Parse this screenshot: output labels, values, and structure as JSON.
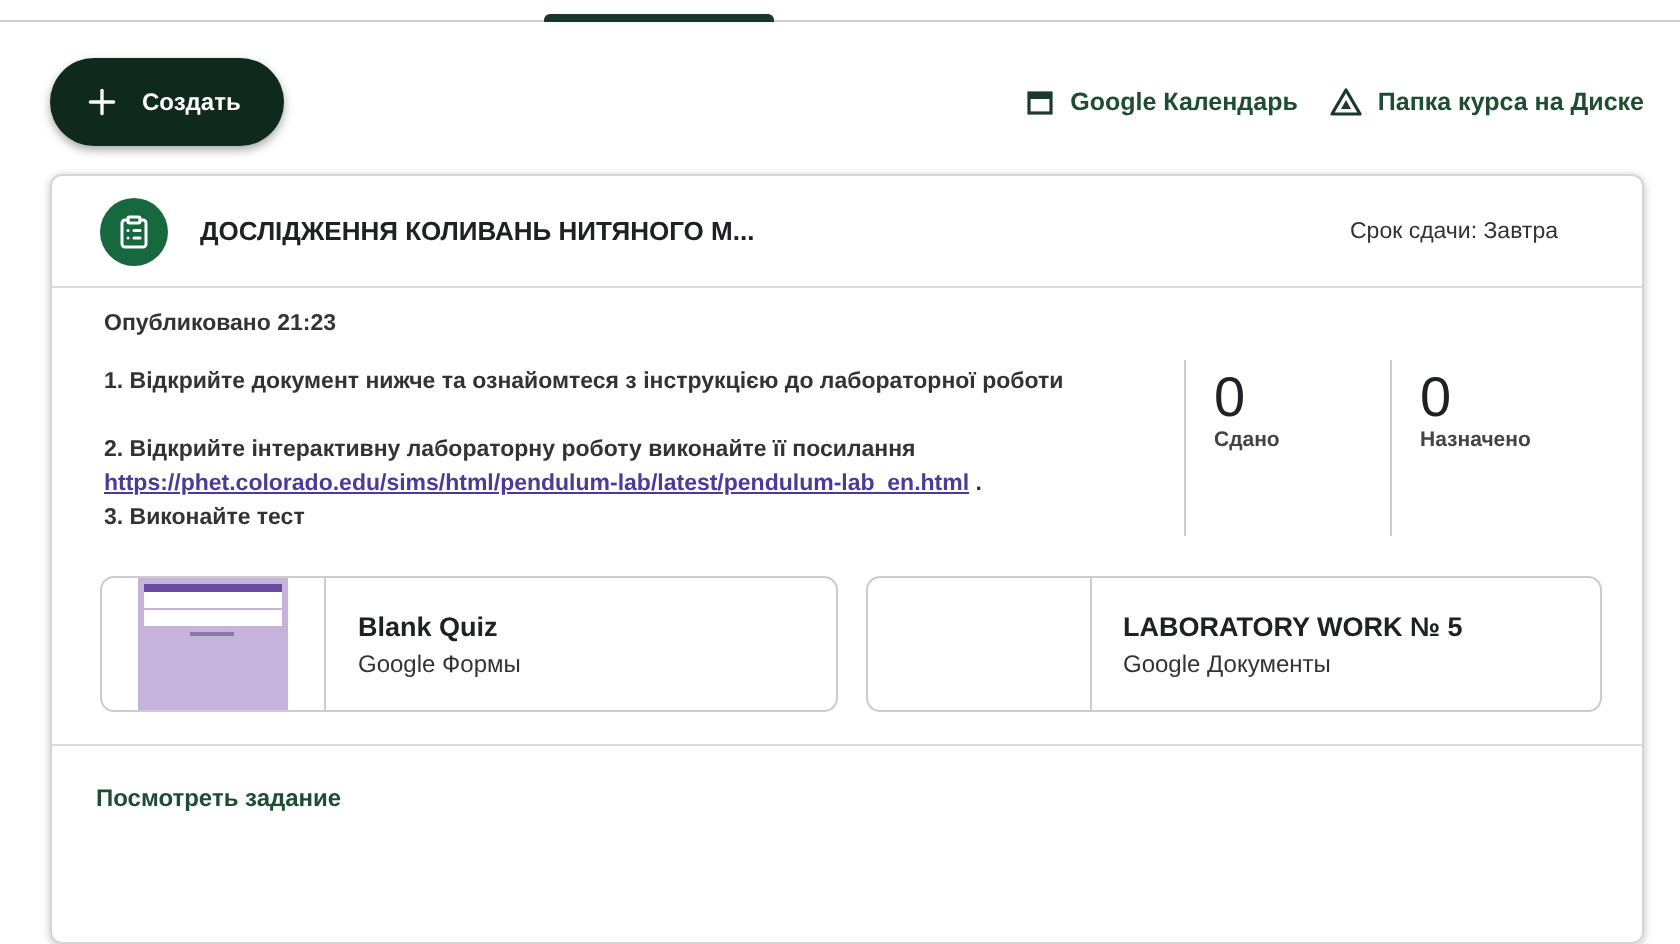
{
  "toolbar": {
    "create_button": "Создать",
    "links": [
      {
        "kind": "calendar",
        "label": "Google Календарь"
      },
      {
        "kind": "drive",
        "label": "Папка курса на Диске"
      }
    ]
  },
  "assignment": {
    "title": "ДОСЛІДЖЕННЯ КОЛИВАНЬ НИТЯНОГО М...",
    "due": "Срок сдачи: Завтра",
    "published": "Опубликовано 21:23",
    "instructions": [
      {
        "text": "1. Відкрийте документ нижче та ознайомтеся з інструкцією до лабораторної роботи"
      },
      {
        "text": "2. Відкрийте інтерактивну лабораторну роботу виконайте її посилання ",
        "link": "https://phet.colorado.edu/sims/html/pendulum-lab/latest/pendulum-lab_en.html",
        "tail": " ."
      },
      {
        "text": "3. Виконайте тест"
      }
    ],
    "stats": [
      {
        "value": "0",
        "label": "Сдано"
      },
      {
        "value": "0",
        "label": "Назначено"
      }
    ],
    "attachments": [
      {
        "kind": "form",
        "title": "Blank Quiz",
        "type": "Google Формы"
      },
      {
        "kind": "document",
        "title": "LABORATORY WORK № 5",
        "type": "Google Документы"
      }
    ],
    "footer_link": "Посмотреть задание"
  }
}
